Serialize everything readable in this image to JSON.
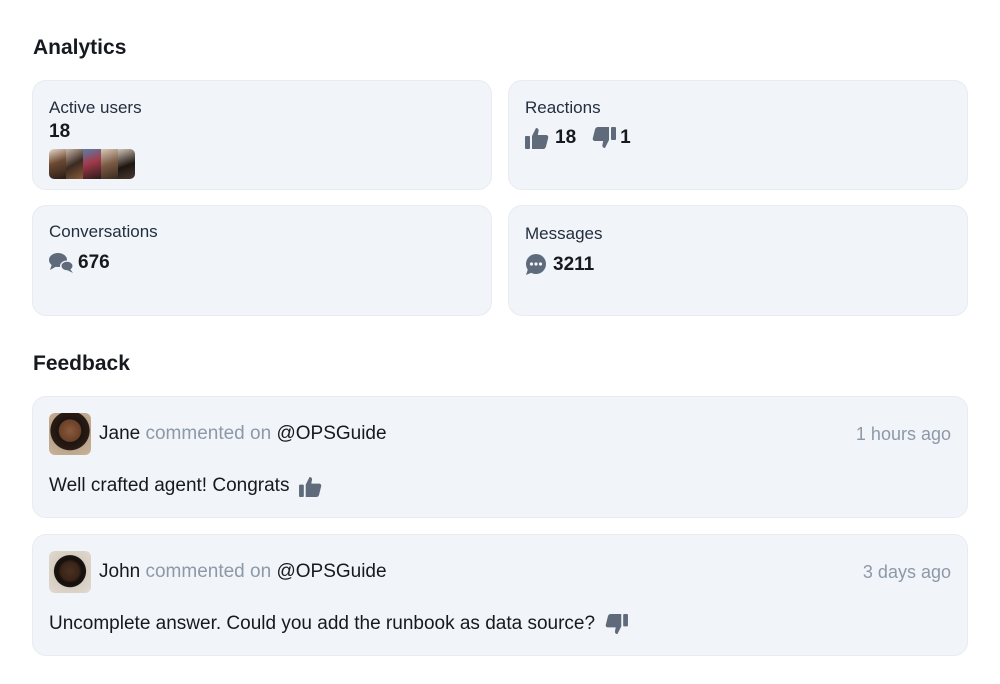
{
  "analytics": {
    "title": "Analytics",
    "active_users": {
      "label": "Active users",
      "value": "18"
    },
    "reactions": {
      "label": "Reactions",
      "likes": "18",
      "dislikes": "1"
    },
    "conversations": {
      "label": "Conversations",
      "value": "676"
    },
    "messages": {
      "label": "Messages",
      "value": "3211"
    }
  },
  "feedback": {
    "title": "Feedback",
    "items": [
      {
        "user": "Jane",
        "action": "commented on",
        "target": "@OPSGuide",
        "time": "1 hours ago",
        "text": "Well crafted agent! Congrats",
        "reaction_icon": "thumbs-up-icon"
      },
      {
        "user": "John",
        "action": "commented on",
        "target": "@OPSGuide",
        "time": "3 days ago",
        "text": "Uncomplete answer. Could you add the runbook as data source?",
        "reaction_icon": "thumbs-down-icon"
      }
    ]
  },
  "colors": {
    "card_background": "#f1f4f9",
    "icon": "#5f6b7a",
    "muted_text": "#8d99a8",
    "text": "#16191f"
  }
}
